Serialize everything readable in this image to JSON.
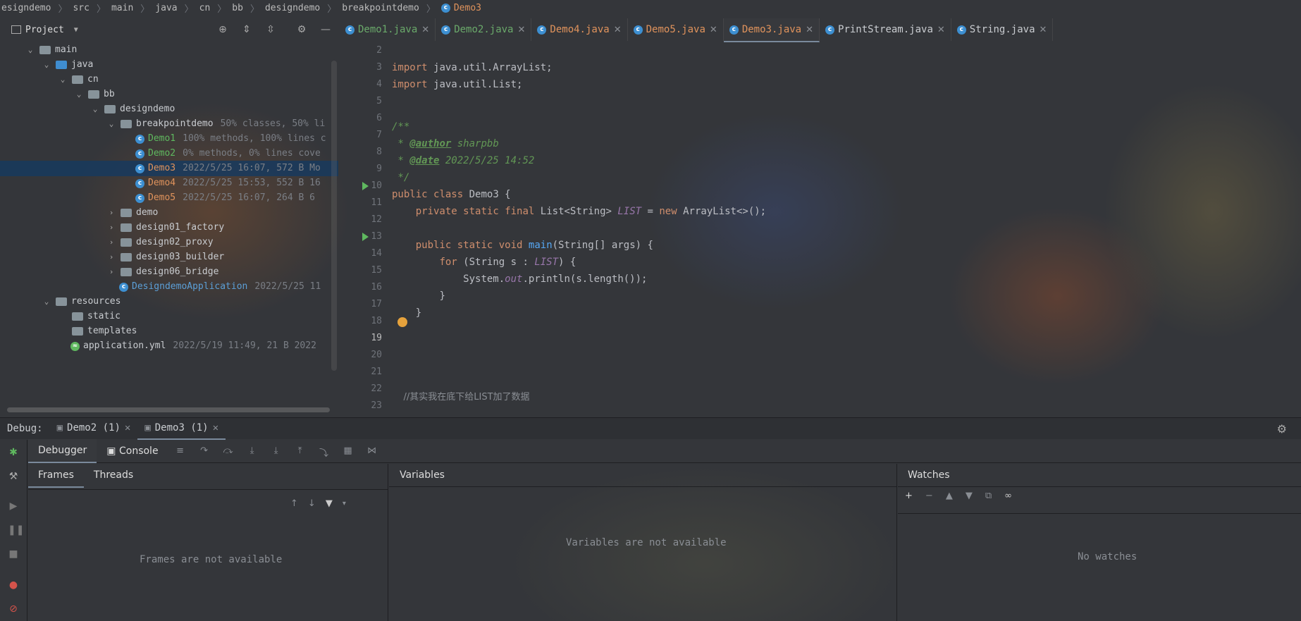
{
  "breadcrumb": [
    "esigndemo",
    "src",
    "main",
    "java",
    "cn",
    "bb",
    "designdemo",
    "breakpointdemo",
    "Demo3"
  ],
  "project": {
    "title": "Project"
  },
  "tree": [
    {
      "label": "main",
      "meta": "",
      "kind": "folder",
      "depth": 2,
      "exp": "v"
    },
    {
      "label": "java",
      "meta": "",
      "kind": "blue",
      "depth": 3,
      "exp": "v"
    },
    {
      "label": "cn",
      "meta": "",
      "kind": "folder",
      "depth": 4,
      "exp": "v"
    },
    {
      "label": "bb",
      "meta": "",
      "kind": "folder",
      "depth": 5,
      "exp": "v"
    },
    {
      "label": "designdemo",
      "meta": "",
      "kind": "folder",
      "depth": 6,
      "exp": "v"
    },
    {
      "label": "breakpointdemo",
      "meta": "50% classes, 50% li",
      "kind": "folder",
      "depth": 7,
      "exp": "v"
    },
    {
      "label": "Demo1",
      "meta": "100% methods, 100% lines c",
      "kind": "class-green",
      "depth": 8,
      "exp": ""
    },
    {
      "label": "Demo2",
      "meta": "0% methods, 0% lines cove",
      "kind": "class-green",
      "depth": 8,
      "exp": ""
    },
    {
      "label": "Demo3",
      "meta": "2022/5/25 16:07, 572 B Mo",
      "kind": "class-orange",
      "depth": 8,
      "exp": "",
      "selected": true
    },
    {
      "label": "Demo4",
      "meta": "2022/5/25 15:53, 552 B 16",
      "kind": "class-orange",
      "depth": 8,
      "exp": ""
    },
    {
      "label": "Demo5",
      "meta": "2022/5/25 16:07, 264 B 6",
      "kind": "class-orange",
      "depth": 8,
      "exp": ""
    },
    {
      "label": "demo",
      "meta": "",
      "kind": "folder",
      "depth": 7,
      "exp": ">"
    },
    {
      "label": "design01_factory",
      "meta": "",
      "kind": "folder",
      "depth": 7,
      "exp": ">"
    },
    {
      "label": "design02_proxy",
      "meta": "",
      "kind": "folder",
      "depth": 7,
      "exp": ">"
    },
    {
      "label": "design03_builder",
      "meta": "",
      "kind": "folder",
      "depth": 7,
      "exp": ">"
    },
    {
      "label": "design06_bridge",
      "meta": "",
      "kind": "folder",
      "depth": 7,
      "exp": ">"
    },
    {
      "label": "DesigndemoApplication",
      "meta": "2022/5/25 11",
      "kind": "class-blue",
      "depth": 7,
      "exp": ""
    },
    {
      "label": "resources",
      "meta": "",
      "kind": "res",
      "depth": 3,
      "exp": "v"
    },
    {
      "label": "static",
      "meta": "",
      "kind": "folder",
      "depth": 4,
      "exp": ""
    },
    {
      "label": "templates",
      "meta": "",
      "kind": "folder",
      "depth": 4,
      "exp": ""
    },
    {
      "label": "application.yml",
      "meta": "2022/5/19 11:49, 21 B 2022",
      "kind": "yml",
      "depth": 4,
      "exp": ""
    }
  ],
  "tabs": [
    {
      "label": "Demo1.java",
      "state": "mod"
    },
    {
      "label": "Demo2.java",
      "state": "mod"
    },
    {
      "label": "Demo4.java",
      "state": "err"
    },
    {
      "label": "Demo5.java",
      "state": "err"
    },
    {
      "label": "Demo3.java",
      "state": "err",
      "active": true
    },
    {
      "label": "PrintStream.java",
      "state": "norm"
    },
    {
      "label": "String.java",
      "state": "norm"
    }
  ],
  "editor": {
    "line_numbers": [
      "2",
      "3",
      "4",
      "5",
      "6",
      "7",
      "8",
      "9",
      "10",
      "11",
      "12",
      "13",
      "14",
      "15",
      "16",
      "17",
      "18",
      "19",
      "20",
      "21",
      "22",
      "23"
    ],
    "lines": {
      "l3": "java.util.ArrayList;",
      "l4": "java.util.List;",
      "l6": "/**",
      "l7_tag": "@author",
      "l7_val": " sharpbb",
      "l8_tag": "@date",
      "l8_val": " 2022/5/25 14:52",
      "l9": " */",
      "l10": "Demo3 {",
      "l11a": "List<String> ",
      "l11b": "LIST",
      "l11c": " = ",
      "l11d": "ArrayList<>();",
      "l13a": "main",
      "l13b": "(String[] args) {",
      "l14a": "(String s : ",
      "l14b": "LIST",
      "l14c": ") {",
      "l15a": "System.",
      "l15b": "out",
      "l15c": ".println(s.length());",
      "l16": "}",
      "l17": "}",
      "l20": "//其实我在底下给LIST加了数据"
    },
    "kw": {
      "import": "import",
      "public": "public",
      "class": "class",
      "private": "private",
      "static": "static",
      "final": "final",
      "new": "new",
      "void": "void",
      "for": "for"
    }
  },
  "debug": {
    "label": "Debug:",
    "sessions": [
      {
        "label": "Demo2 (1)"
      },
      {
        "label": "Demo3 (1)",
        "active": true
      }
    ],
    "tabs": {
      "debugger": "Debugger",
      "console": "Console"
    },
    "frames_tab": "Frames",
    "threads_tab": "Threads",
    "variables_title": "Variables",
    "watches_title": "Watches",
    "frames_empty": "Frames are not available",
    "variables_empty": "Variables are not available",
    "watches_empty": "No watches"
  }
}
